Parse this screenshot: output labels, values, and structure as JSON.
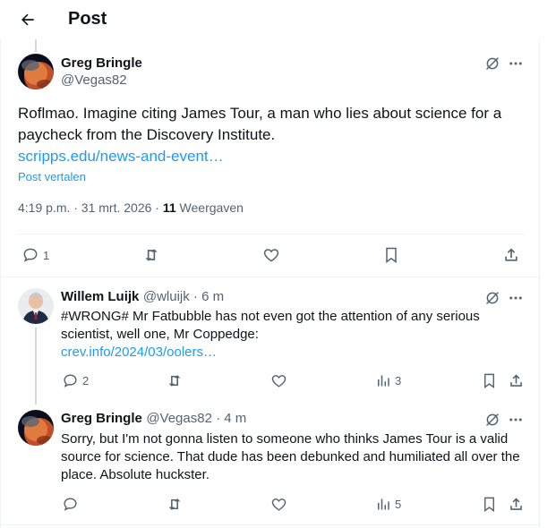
{
  "header": {
    "title": "Post"
  },
  "main_post": {
    "author_name": "Greg Bringle",
    "author_handle": "@Vegas82",
    "text": "Roflmao. Imagine citing James Tour, a man who lies about science for a paycheck from the Discovery Institute.",
    "link": "scripps.edu/news-and-event…",
    "translate": "Post vertalen",
    "timestamp": "4:19 p.m. · 31 mrt. 2026 · ",
    "views_count": "11",
    "views_label": " Weergaven",
    "reply_count": "1"
  },
  "replies": [
    {
      "author_name": "Willem Luijk",
      "author_handle": "@wluijk · 6 m",
      "text": "#WRONG# Mr Fatbubble has not even got the attention of any serious scientist, well one, Mr Coppedge:",
      "link": "crev.info/2024/03/oolers…",
      "reply_count": "2",
      "views_count": "3"
    },
    {
      "author_name": "Greg Bringle",
      "author_handle": "@Vegas82 · 4 m",
      "text": "Sorry, but I'm not gonna listen to someone who thinks James Tour is a valid source for science. That dude has been debunked and humiliated all over the place. Absolute huckster.",
      "views_count": "5"
    }
  ],
  "colors": {
    "accent": "#1d9bf0",
    "secondary_text": "#536471",
    "divider": "#eff3f4"
  },
  "icons": [
    "back-arrow-icon",
    "grok-icon",
    "more-icon",
    "reply-icon",
    "repost-icon",
    "like-icon",
    "bookmark-icon",
    "share-icon",
    "views-icon"
  ]
}
